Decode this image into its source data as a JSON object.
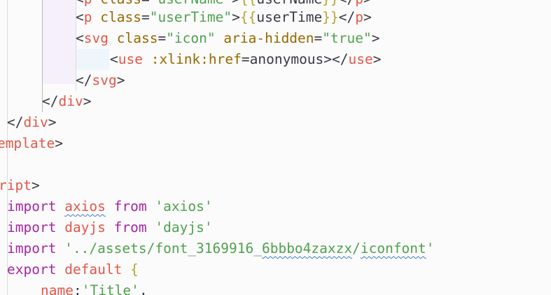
{
  "code": {
    "l1": {
      "lt": "<",
      "tag": "p",
      "attr": "class",
      "eq": "=",
      "val": "\"userName\"",
      "gt": ">",
      "mo": "{{",
      "expr": "userName",
      "mc": "}}",
      "close": "</",
      "ctag": "p",
      "cgt": ">"
    },
    "l2": {
      "lt": "<",
      "tag": "p",
      "attr": "class",
      "eq": "=",
      "val": "\"userTime\"",
      "gt": ">",
      "mo": "{{",
      "expr": "userTime",
      "mc": "}}",
      "close": "</",
      "ctag": "p",
      "cgt": ">"
    },
    "l3": {
      "lt": "<",
      "tag": "svg",
      "attr1": "class",
      "eq1": "=",
      "val1": "\"icon\"",
      "attr2": "aria-hidden",
      "eq2": "=",
      "val2": "\"true\"",
      "gt": ">"
    },
    "l4": {
      "lt": "<",
      "tag": "use",
      "attr": ":xlink:href",
      "eq": "=",
      "val": "anonymous",
      "close": "></",
      "ctag": "use",
      "cgt": ">"
    },
    "l5": {
      "close": "</",
      "tag": "svg",
      "gt": ">"
    },
    "l6": {
      "close": "</",
      "tag": "div",
      "gt": ">"
    },
    "l7": {
      "close": "</",
      "tag": "div",
      "gt": ">"
    },
    "l8": {
      "tag": "emplate",
      "gt": ">"
    },
    "l10": {
      "tag": "ript",
      "gt": ">"
    },
    "l11": {
      "kw": "import",
      "id": "axios",
      "from": "from",
      "str": "'axios'"
    },
    "l12": {
      "kw": "import",
      "id": "dayjs",
      "from": "from",
      "str": "'dayjs'"
    },
    "l13": {
      "kw": "import",
      "str_a": "'../assets/font_3169916_",
      "str_b": "6bbbo4zaxzx",
      "str_c": "/",
      "str_d": "iconfont",
      "str_e": "'"
    },
    "l14": {
      "kw1": "export",
      "kw2": "default",
      "brace": "{"
    },
    "l15": {
      "key": "name",
      "colon": ":",
      "str": "'Title'",
      "comma": ","
    }
  }
}
